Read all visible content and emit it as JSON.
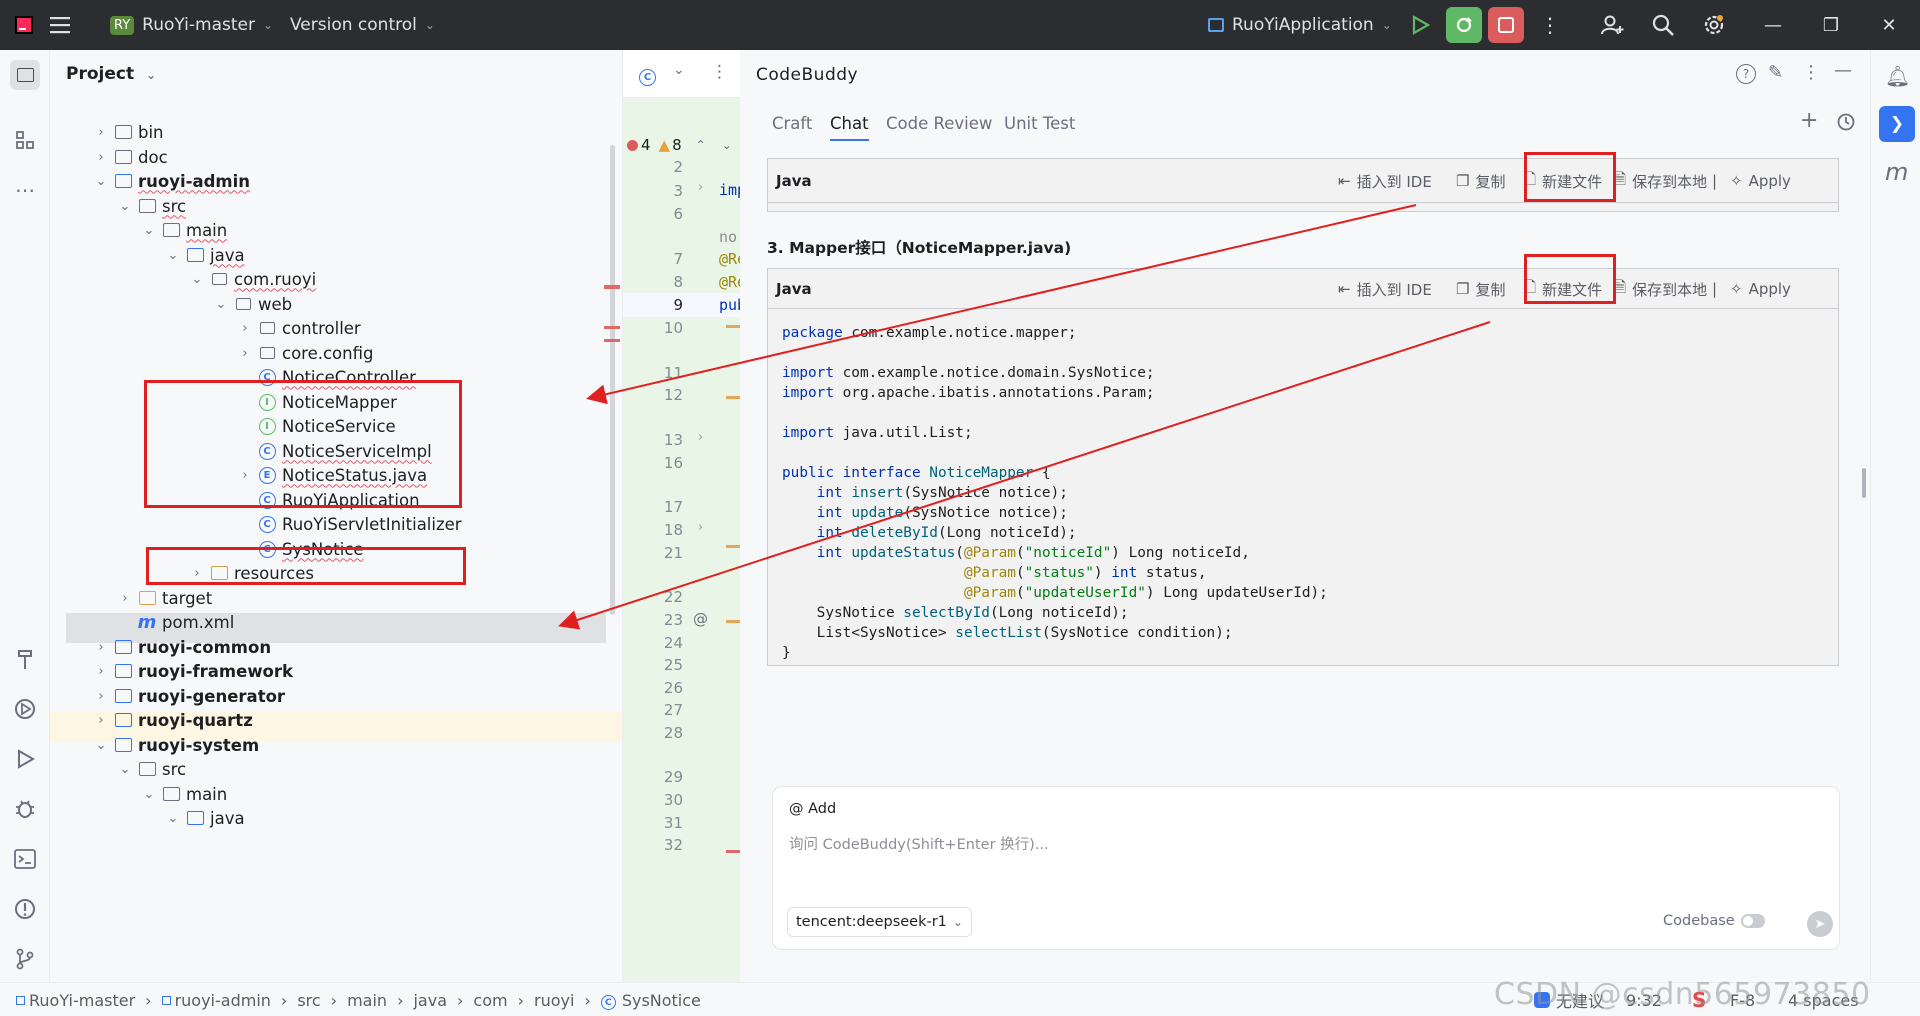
{
  "titlebar": {
    "project_badge": "RY",
    "project_name": "RuoYi-master",
    "vcs": "Version control",
    "run_config": "RuoYiApplication"
  },
  "project": {
    "header": "Project",
    "tree": [
      {
        "label": "bin",
        "kind": "folder"
      },
      {
        "label": "doc",
        "kind": "folder"
      },
      {
        "label": "ruoyi-admin",
        "kind": "module"
      },
      {
        "label": "src",
        "kind": "folder"
      },
      {
        "label": "main",
        "kind": "folder"
      },
      {
        "label": "java",
        "kind": "folder"
      },
      {
        "label": "com.ruoyi",
        "kind": "package"
      },
      {
        "label": "web",
        "kind": "package"
      },
      {
        "label": "controller",
        "kind": "package"
      },
      {
        "label": "core.config",
        "kind": "package"
      },
      {
        "label": "NoticeController",
        "kind": "class"
      },
      {
        "label": "NoticeMapper",
        "kind": "interface"
      },
      {
        "label": "NoticeService",
        "kind": "interface"
      },
      {
        "label": "NoticeServiceImpl",
        "kind": "class"
      },
      {
        "label": "NoticeStatus.java",
        "kind": "enum"
      },
      {
        "label": "RuoYiApplication",
        "kind": "class"
      },
      {
        "label": "RuoYiServletInitializer",
        "kind": "class"
      },
      {
        "label": "SysNotice",
        "kind": "class"
      },
      {
        "label": "resources",
        "kind": "folder"
      },
      {
        "label": "target",
        "kind": "folder"
      },
      {
        "label": "pom.xml",
        "kind": "maven"
      },
      {
        "label": "ruoyi-common",
        "kind": "module"
      },
      {
        "label": "ruoyi-framework",
        "kind": "module"
      },
      {
        "label": "ruoyi-generator",
        "kind": "module"
      },
      {
        "label": "ruoyi-quartz",
        "kind": "module"
      },
      {
        "label": "ruoyi-system",
        "kind": "module"
      },
      {
        "label": "src",
        "kind": "folder"
      },
      {
        "label": "main",
        "kind": "folder"
      },
      {
        "label": "java",
        "kind": "folder"
      }
    ]
  },
  "editor": {
    "errors": "4",
    "warnings": "8",
    "line_numbers": [
      "2",
      "3",
      "6",
      "7",
      "8",
      "9",
      "10",
      "11",
      "12",
      "13",
      "16",
      "17",
      "18",
      "21",
      "22",
      "23",
      "24",
      "25",
      "26",
      "27",
      "28",
      "29",
      "30",
      "31",
      "32"
    ],
    "fragments": [
      "imp",
      "no",
      "@Re",
      "@Re",
      "pub"
    ]
  },
  "codebuddy": {
    "title": "CodeBuddy",
    "tabs": [
      "Craft",
      "Chat",
      "Code Review",
      "Unit Test"
    ],
    "active_tab": "Chat",
    "card_lang": "Java",
    "actions": {
      "insert": "插入到 IDE",
      "copy": "复制",
      "new_file": "新建文件",
      "save_local": "保存到本地",
      "apply": "Apply"
    },
    "section_heading": "3. Mapper接口（NoticeMapper.java)",
    "code_lines": [
      "package com.example.notice.mapper;",
      "",
      "import com.example.notice.domain.SysNotice;",
      "import org.apache.ibatis.annotations.Param;",
      "",
      "import java.util.List;",
      "",
      "public interface NoticeMapper {",
      "    int insert(SysNotice notice);",
      "    int update(SysNotice notice);",
      "    int deleteById(Long noticeId);",
      "    int updateStatus(@Param(\"noticeId\") Long noticeId,",
      "                     @Param(\"status\") int status,",
      "                     @Param(\"updateUserId\") Long updateUserId);",
      "    SysNotice selectById(Long noticeId);",
      "    List<SysNotice> selectList(SysNotice condition);",
      "}"
    ],
    "input": {
      "add_label": "@ Add",
      "placeholder": "询问 CodeBuddy(Shift+Enter 换行)...",
      "model": "tencent:deepseek-r1",
      "codebase": "Codebase"
    }
  },
  "status": {
    "breadcrumb": [
      "RuoYi-master",
      "ruoyi-admin",
      "src",
      "main",
      "java",
      "com",
      "ruoyi",
      "SysNotice"
    ],
    "advice": "无建议",
    "position": "9:32",
    "encoding": "F-8",
    "indent": "4 spaces",
    "watermark": "CSDN @csdn565973850"
  },
  "colors": {
    "accent": "#3574f0",
    "annotation_red": "#e02020",
    "titlebar_bg": "#2b2d30"
  }
}
